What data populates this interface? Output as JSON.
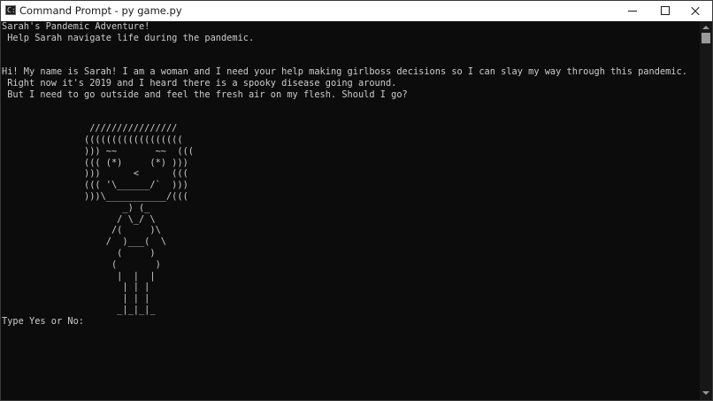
{
  "window": {
    "title": "Command Prompt - py  game.py",
    "icon_glyph": "C:\\",
    "controls": [
      "minimize",
      "maximize",
      "close"
    ]
  },
  "console": {
    "lines": [
      "Sarah's Pandemic Adventure!",
      " Help Sarah navigate life during the pandemic.",
      "",
      "",
      "Hi! My name is Sarah! I am a woman and I need your help making girlboss decisions so I can slay my way through this pandemic.",
      " Right now it's 2019 and I heard there is a spooky disease going around.",
      " But I need to go outside and feel the fresh air on my flesh. Should I go?",
      "",
      "",
      "                ////////////////",
      "               ((((((((((((((((((",
      "               ))) ~~       ~~  (((",
      "               ((( (*)     (*) )))",
      "               )))      <      (((",
      "               ((( '\\______/`  )))",
      "               )))\\___________/(((",
      "                      _) (_",
      "                     / \\_/ \\",
      "                    /(     )\\",
      "                   /  )___(  \\",
      "                     (     )",
      "                    (       )",
      "                     |  |  |",
      "                      | | |",
      "                      | | |",
      "                     _|_|_|_",
      "Type Yes or No: "
    ]
  },
  "colors": {
    "console_background": "#0c0c0c",
    "console_text": "#cccccc",
    "titlebar_background": "#ffffff"
  }
}
